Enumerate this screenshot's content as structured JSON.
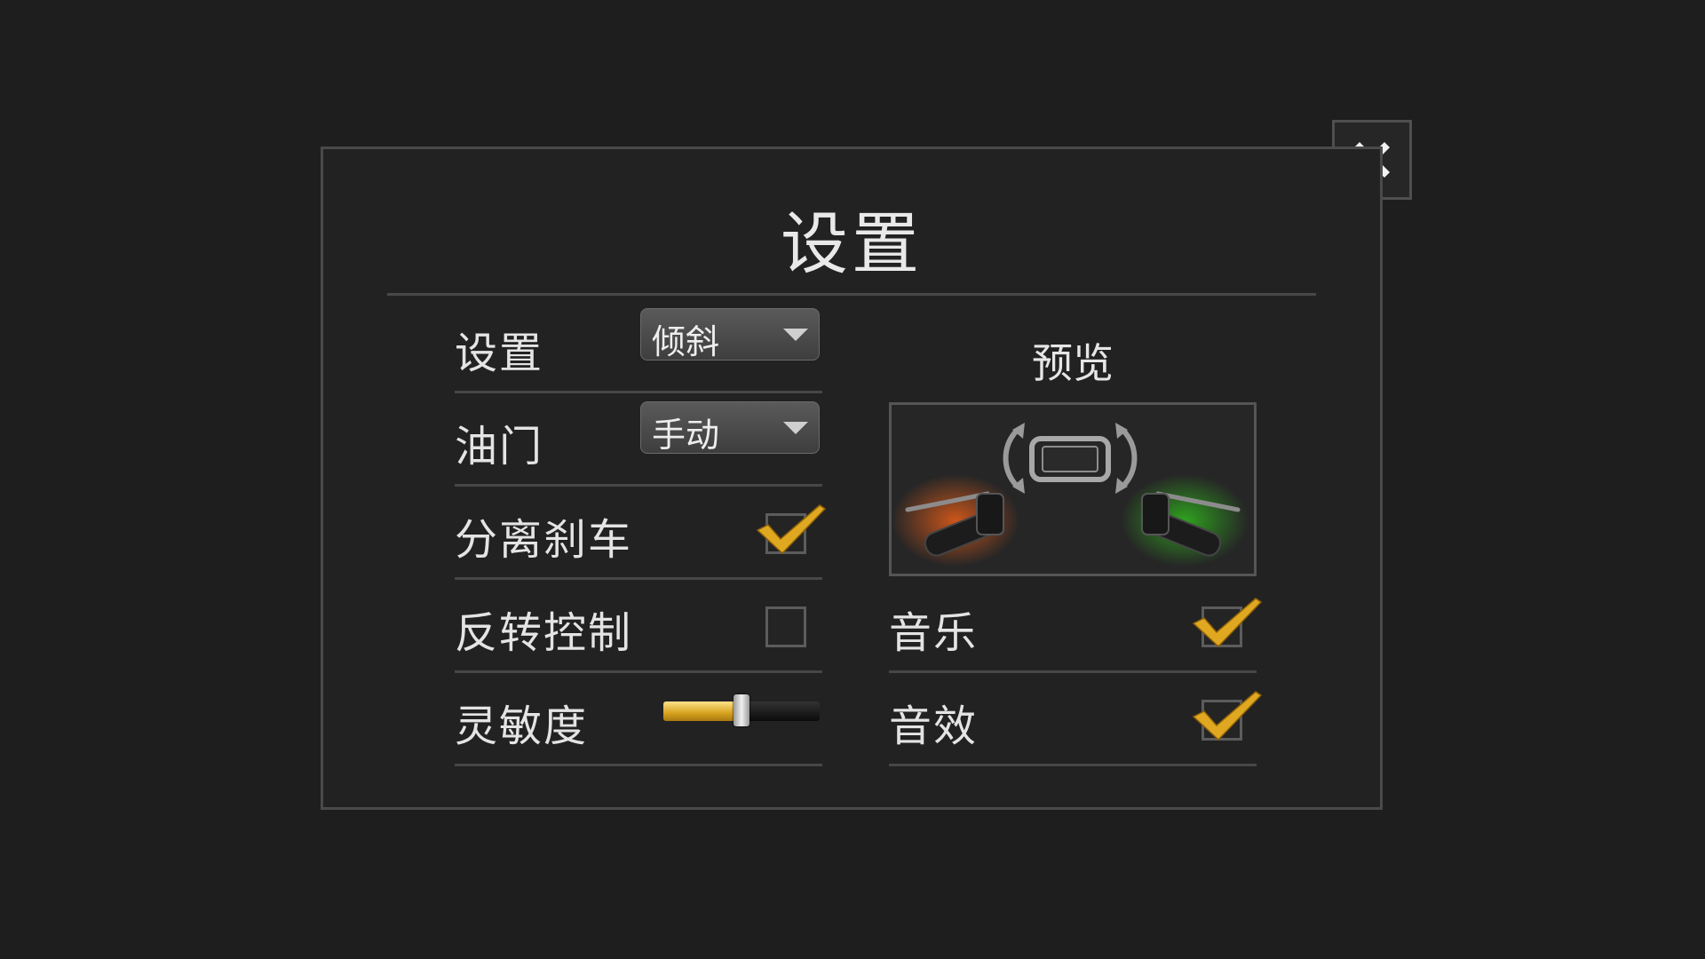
{
  "dialog": {
    "title": "设置"
  },
  "left_rows": {
    "control_mode": {
      "label": "设置",
      "value": "倾斜"
    },
    "throttle": {
      "label": "油门",
      "value": "手动"
    },
    "separate_brakes": {
      "label": "分离刹车",
      "checked": true
    },
    "invert_controls": {
      "label": "反转控制",
      "checked": false
    },
    "sensitivity": {
      "label": "灵敏度",
      "value": 0.5
    }
  },
  "preview": {
    "label": "预览"
  },
  "right_rows": {
    "music": {
      "label": "音乐",
      "checked": true
    },
    "sound_effects": {
      "label": "音效",
      "checked": true
    }
  },
  "colors": {
    "accent_gold": "#e0a820",
    "left_glow": "#c8500f",
    "right_glow": "#2a9a1a"
  },
  "icons": {
    "close": "close-x-icon",
    "dropdown": "chevron-down-icon",
    "check": "checkmark-icon",
    "rotate_device": "rotate-device-icon",
    "brake_lever": "brake-lever-icon",
    "throttle_grip": "throttle-grip-icon"
  }
}
